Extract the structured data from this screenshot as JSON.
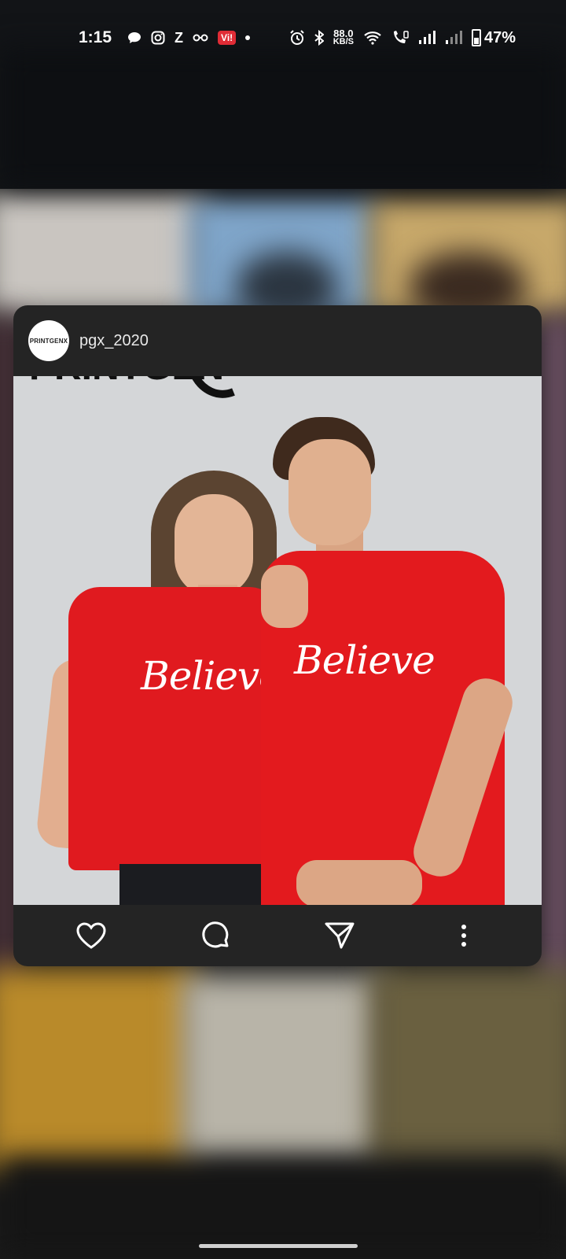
{
  "status_bar": {
    "time": "1:15",
    "app_icons": [
      "chat-bubble-icon",
      "instagram-icon",
      "z-app-icon",
      "glasses-icon",
      "vi-app-icon",
      "notification-dot-icon"
    ],
    "vi_label": "Vi!",
    "right_icons": [
      "alarm-icon",
      "bluetooth-icon",
      "wifi-icon",
      "wifi-call-icon",
      "signal-icon",
      "signal-weak-icon"
    ],
    "net_speed_value": "88.0",
    "net_speed_unit": "KB/S",
    "battery_percent": "47%"
  },
  "post": {
    "username": "pgx_2020",
    "avatar_text": "PRINTGENX",
    "photo_logo_text": "PRINTGEN",
    "tee_text_left": "Believe",
    "tee_text_right": "Believe",
    "actions": [
      "heart-icon",
      "comment-icon",
      "send-icon",
      "more-vertical-icon"
    ]
  }
}
